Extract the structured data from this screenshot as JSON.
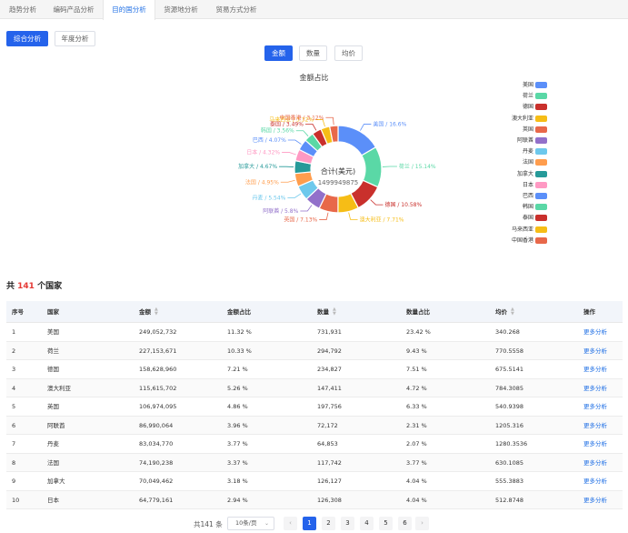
{
  "nav": {
    "tabs": [
      "趋势分析",
      "编码产品分析",
      "目的国分析",
      "货源地分析",
      "贸易方式分析"
    ],
    "active_tab": "目的国分析"
  },
  "subtabs": [
    "综合分析",
    "年度分析"
  ],
  "metric_tabs": [
    "金额",
    "数量",
    "均价"
  ],
  "chart": {
    "title": "金额占比",
    "center_label": "合计(美元)",
    "center_value": "1499949875"
  },
  "chart_data": {
    "type": "pie",
    "title": "金额占比",
    "slices": [
      {
        "name": "美国",
        "percent": 16.6,
        "label": "美国 / 16.6%",
        "color": "#5b8ff9"
      },
      {
        "name": "荷兰",
        "percent": 15.14,
        "label": "荷兰 / 15.14%",
        "color": "#5ad8a6"
      },
      {
        "name": "德国",
        "percent": 10.58,
        "label": "德国 / 10.58%",
        "color": "#c9302c"
      },
      {
        "name": "澳大利亚",
        "percent": 7.71,
        "label": "澳大利亚 / 7.71%",
        "color": "#f6bd16"
      },
      {
        "name": "英国",
        "percent": 7.13,
        "label": "英国 / 7.13%",
        "color": "#e8684a"
      },
      {
        "name": "阿联酋",
        "percent": 5.8,
        "label": "阿联酋 / 5.8%",
        "color": "#9270ca"
      },
      {
        "name": "丹麦",
        "percent": 5.54,
        "label": "丹麦 / 5.54%",
        "color": "#6dc8ec"
      },
      {
        "name": "法国",
        "percent": 4.95,
        "label": "法国 / 4.95%",
        "color": "#ff9d4d"
      },
      {
        "name": "加拿大",
        "percent": 4.67,
        "label": "加拿大 / 4.67%",
        "color": "#269a99"
      },
      {
        "name": "日本",
        "percent": 4.32,
        "label": "日本 / 4.32%",
        "color": "#ff99c3"
      },
      {
        "name": "巴西",
        "percent": 4.07,
        "label": "巴西 / 4.07%",
        "color": "#5b8ff9"
      },
      {
        "name": "韩国",
        "percent": 3.56,
        "label": "韩国 / 3.56%",
        "color": "#5ad8a6"
      },
      {
        "name": "泰国",
        "percent": 3.49,
        "label": "泰国 / 3.49%",
        "color": "#c9302c"
      },
      {
        "name": "马来西亚",
        "percent": 3.32,
        "label": "马来西亚 / 3.32%",
        "color": "#f6bd16"
      },
      {
        "name": "中国香港",
        "percent": 3.12,
        "label": "中国香港 / 3.12%",
        "color": "#e8684a"
      }
    ],
    "legend_position": "right"
  },
  "summary": {
    "prefix": "共 ",
    "count": "141",
    "suffix": " 个国家"
  },
  "table": {
    "columns": [
      "序号",
      "国家",
      "金额",
      "金额占比",
      "数量",
      "数量占比",
      "均价",
      "操作"
    ],
    "rows": [
      [
        "1",
        "美国",
        "249,052,732",
        "11.32 %",
        "731,931",
        "23.42 %",
        "340.268",
        "更多分析"
      ],
      [
        "2",
        "荷兰",
        "227,153,671",
        "10.33 %",
        "294,792",
        "9.43 %",
        "770.5558",
        "更多分析"
      ],
      [
        "3",
        "德国",
        "158,628,960",
        "7.21 %",
        "234,827",
        "7.51 %",
        "675.5141",
        "更多分析"
      ],
      [
        "4",
        "澳大利亚",
        "115,615,702",
        "5.26 %",
        "147,411",
        "4.72 %",
        "784.3085",
        "更多分析"
      ],
      [
        "5",
        "英国",
        "106,974,095",
        "4.86 %",
        "197,756",
        "6.33 %",
        "540.9398",
        "更多分析"
      ],
      [
        "6",
        "阿联酋",
        "86,990,064",
        "3.96 %",
        "72,172",
        "2.31 %",
        "1205.316",
        "更多分析"
      ],
      [
        "7",
        "丹麦",
        "83,034,770",
        "3.77 %",
        "64,853",
        "2.07 %",
        "1280.3536",
        "更多分析"
      ],
      [
        "8",
        "法国",
        "74,190,238",
        "3.37 %",
        "117,742",
        "3.77 %",
        "630.1085",
        "更多分析"
      ],
      [
        "9",
        "加拿大",
        "70,049,462",
        "3.18 %",
        "126,127",
        "4.04 %",
        "555.3883",
        "更多分析"
      ],
      [
        "10",
        "日本",
        "64,779,161",
        "2.94 %",
        "126,308",
        "4.04 %",
        "512.8748",
        "更多分析"
      ]
    ]
  },
  "pagination": {
    "total_label": "共141 条",
    "page_size": "10条/页",
    "pages": [
      "1",
      "2",
      "3",
      "4",
      "5",
      "6"
    ],
    "current": "1",
    "prev": "‹",
    "next": "›"
  }
}
